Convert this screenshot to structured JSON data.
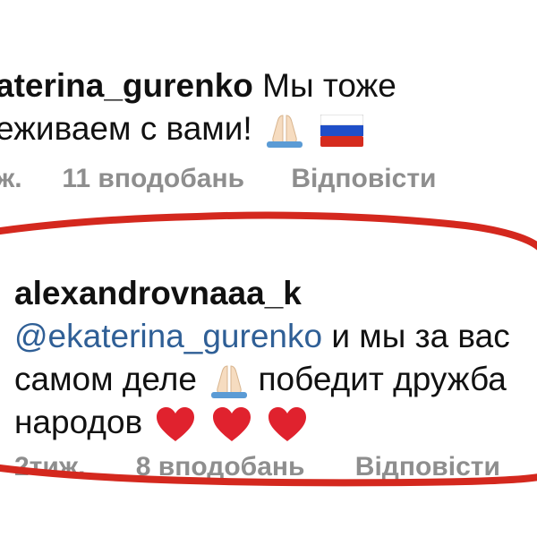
{
  "comment_1": {
    "username": "aterina_gurenko",
    "text_line1": "Мы тоже",
    "text_line2": "еживаем с вами!",
    "emojis": [
      "praying-hands-icon",
      "russia-flag-icon"
    ],
    "meta": {
      "time": "ж.",
      "likes": "11 вподобань",
      "reply": "Відповісти"
    }
  },
  "comment_2": {
    "username": "alexandrovnaaa_k",
    "mention": "@ekaterina_gurenko",
    "text_line1_rest": " и мы за вас",
    "text_line2_a": "самом деле ",
    "text_line2_b": "победит дружба",
    "text_line3": "народов ",
    "emojis": [
      "praying-hands-icon",
      "heart-icon",
      "heart-icon",
      "heart-icon"
    ],
    "meta": {
      "time": "2тиж.",
      "likes": "8 вподобань",
      "reply": "Відповісти"
    }
  },
  "colors": {
    "text": "#111111",
    "muted": "#8e8e8e",
    "mention": "#2f5f96",
    "annotation": "#d4281e",
    "heart": "#e0222e"
  }
}
